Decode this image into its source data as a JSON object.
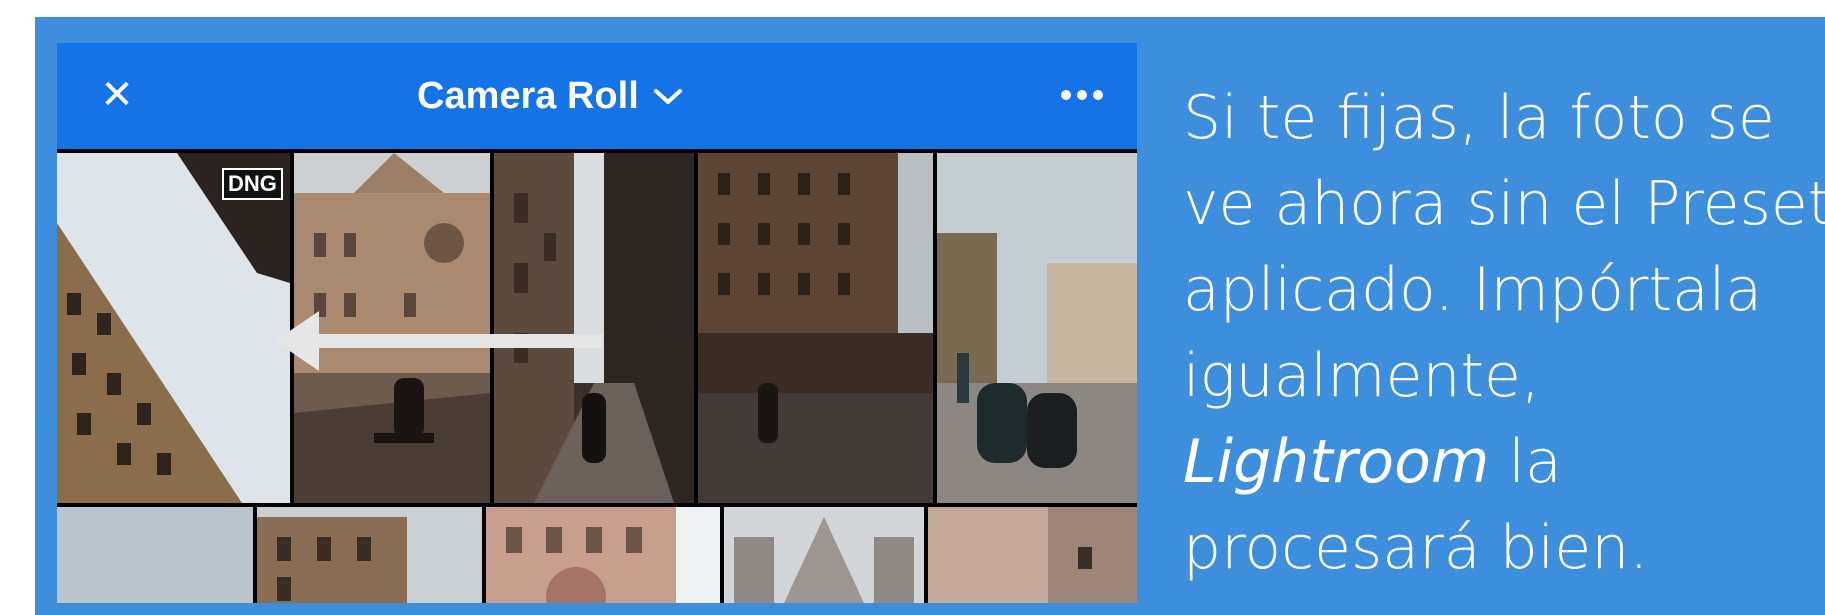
{
  "header": {
    "close_icon": "close-icon",
    "album_title": "Camera Roll",
    "dropdown_icon": "chevron-down-icon",
    "more_icon": "more-options-icon"
  },
  "photos": {
    "badge": "DNG",
    "top_row_count": 5,
    "bottom_row_count": 5
  },
  "caption": {
    "line1": "Si te fijas, la foto se",
    "line2": "ve ahora sin el Preset",
    "line3": "aplicado. Impórtala",
    "line4": "igualmente,",
    "line5_italic": "Lightroom",
    "line5_rest": " la",
    "line6": "procesará bien."
  },
  "colors": {
    "frame_blue": "#3d8fde",
    "appbar_blue": "#1473e6",
    "arrow": "#e6e6e6",
    "text": "#ffffff"
  }
}
